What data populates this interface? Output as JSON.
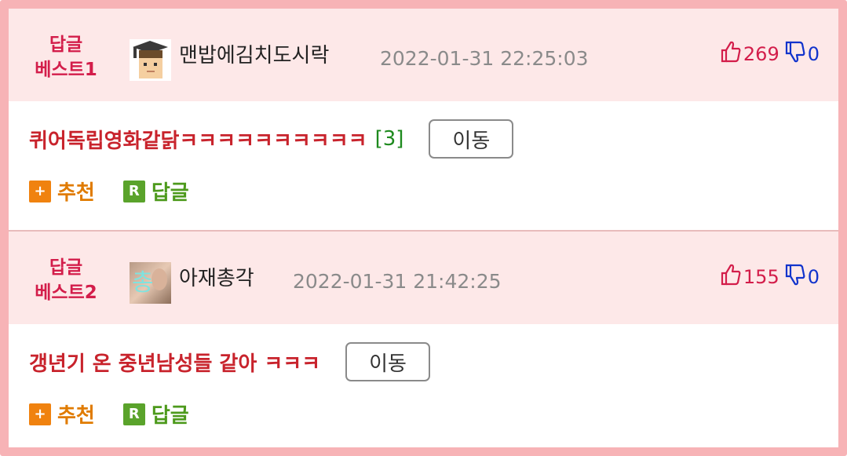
{
  "replies": [
    {
      "best_line1": "답글",
      "best_line2": "베스트1",
      "nickname": "맨밥에김치도시락",
      "datetime": "2022-01-31 22:25:03",
      "up_count": "269",
      "down_count": "0",
      "text": "퀴어독립영화같닭ㅋㅋㅋㅋㅋㅋㅋㅋㅋㅋ",
      "comment_count": "[3]",
      "move_label": "이동",
      "recommend_label": "추천",
      "reply_label": "답글",
      "recommend_icon": "+",
      "reply_icon": "R",
      "avatar_icon": "graduation-cap-boy-avatar"
    },
    {
      "best_line1": "답글",
      "best_line2": "베스트2",
      "nickname": "아재총각",
      "datetime": "2022-01-31 21:42:25",
      "up_count": "155",
      "down_count": "0",
      "text": "갱년기 온 중년남성들 같아 ㅋㅋㅋ",
      "comment_count": "",
      "move_label": "이동",
      "recommend_label": "추천",
      "reply_label": "답글",
      "recommend_icon": "+",
      "reply_icon": "R",
      "avatar_icon": "photo-avatar-with-text"
    }
  ],
  "avatar2_text": "총",
  "colors": {
    "border": "#f7b3b6",
    "header_bg": "#fde8e8",
    "best_label": "#d31d4a",
    "reply_text": "#c8232c",
    "up": "#d31d4a",
    "down": "#1133cc",
    "recommend": "#f0820f",
    "reply": "#5aa32b",
    "comment_count": "#1e8a1e"
  }
}
